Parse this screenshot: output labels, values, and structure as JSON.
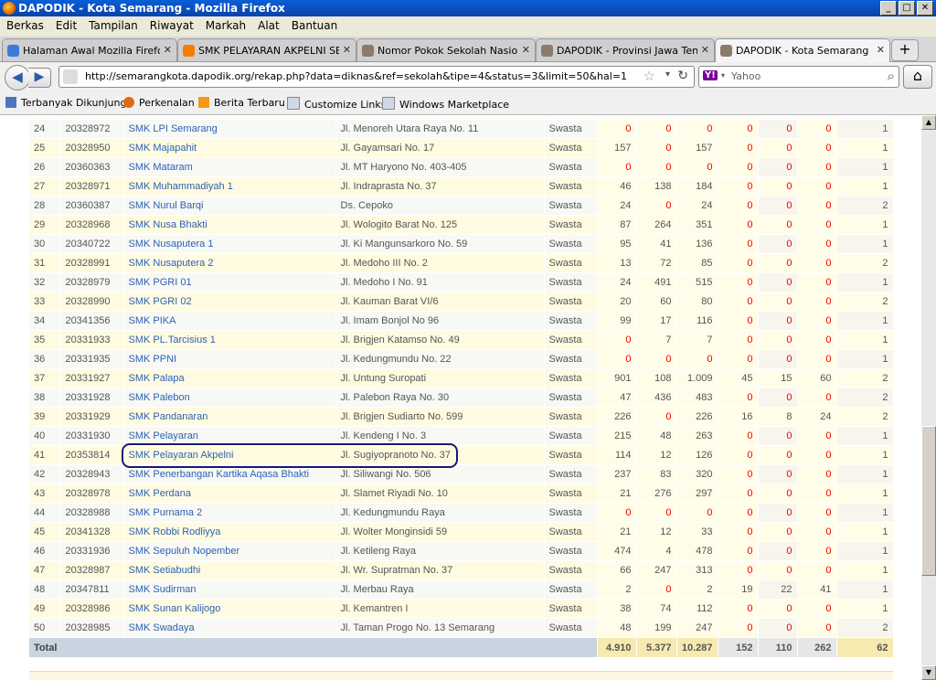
{
  "window": {
    "title": "DAPODIK - Kota Semarang - Mozilla Firefox",
    "buttons": [
      "_",
      "□",
      "✕"
    ]
  },
  "menu": [
    "Berkas",
    "Edit",
    "Tampilan",
    "Riwayat",
    "Markah",
    "Alat",
    "Bantuan"
  ],
  "tabs": [
    {
      "label": "Halaman Awal Mozilla Firefox",
      "icon": "google-icon",
      "color": "#3b7bd8"
    },
    {
      "label": "SMK PELAYARAN AKPELNI SE...",
      "icon": "blogger-icon",
      "color": "#f57d00"
    },
    {
      "label": "Nomor Pokok Sekolah Nasiona...",
      "icon": "dapodik-icon",
      "color": "#8a7b6a"
    },
    {
      "label": "DAPODIK - Provinsi Jawa Ten...",
      "icon": "dapodik-icon",
      "color": "#8a7b6a"
    },
    {
      "label": "DAPODIK - Kota Semarang",
      "icon": "dapodik-icon",
      "color": "#8a7b6a"
    }
  ],
  "nav": {
    "url": "http://semarangkota.dapodik.org/rekap.php?data=diknas&ref=sekolah&tipe=4&status=3&limit=50&hal=1",
    "search_placeholder": "Yahoo",
    "search_logo": "Y!"
  },
  "bookmarks": [
    {
      "label": "Terbanyak Dikunjungi",
      "icon": "search-doc-icon",
      "color": "#4a78c0"
    },
    {
      "label": "Perkenalan",
      "icon": "firefox-icon",
      "color": "#e06a10"
    },
    {
      "label": "Berita Terbaru",
      "icon": "rss-icon",
      "color": "#f39a1a"
    },
    {
      "label": "Customize Links",
      "icon": "page-icon",
      "color": "#cfd8e6"
    },
    {
      "label": "Windows Marketplace",
      "icon": "page-icon",
      "color": "#cfd8e6"
    }
  ],
  "table": {
    "rows": [
      [
        "24",
        "20328972",
        "SMK LPI Semarang",
        "Jl. Menoreh Utara Raya No. 11",
        "Swasta",
        "0",
        "0",
        "0",
        "0",
        "0",
        "0",
        "1"
      ],
      [
        "25",
        "20328950",
        "SMK Majapahit",
        "Jl. Gayamsari No. 17",
        "Swasta",
        "157",
        "0",
        "157",
        "0",
        "0",
        "0",
        "1"
      ],
      [
        "26",
        "20360363",
        "SMK Mataram",
        "Jl. MT Haryono No. 403-405",
        "Swasta",
        "0",
        "0",
        "0",
        "0",
        "0",
        "0",
        "1"
      ],
      [
        "27",
        "20328971",
        "SMK Muhammadiyah 1",
        "Jl. Indraprasta No. 37",
        "Swasta",
        "46",
        "138",
        "184",
        "0",
        "0",
        "0",
        "1"
      ],
      [
        "28",
        "20360387",
        "SMK Nurul Barqi",
        "Ds. Cepoko",
        "Swasta",
        "24",
        "0",
        "24",
        "0",
        "0",
        "0",
        "2"
      ],
      [
        "29",
        "20328968",
        "SMK Nusa Bhakti",
        "Jl. Wologito Barat No. 125",
        "Swasta",
        "87",
        "264",
        "351",
        "0",
        "0",
        "0",
        "1"
      ],
      [
        "30",
        "20340722",
        "SMK Nusaputera 1",
        "Jl. Ki Mangunsarkoro No. 59",
        "Swasta",
        "95",
        "41",
        "136",
        "0",
        "0",
        "0",
        "1"
      ],
      [
        "31",
        "20328991",
        "SMK Nusaputera 2",
        "Jl. Medoho III No. 2",
        "Swasta",
        "13",
        "72",
        "85",
        "0",
        "0",
        "0",
        "2"
      ],
      [
        "32",
        "20328979",
        "SMK PGRI 01",
        "Jl. Medoho I No. 91",
        "Swasta",
        "24",
        "491",
        "515",
        "0",
        "0",
        "0",
        "1"
      ],
      [
        "33",
        "20328990",
        "SMK PGRI 02",
        "Jl. Kauman Barat VI/6",
        "Swasta",
        "20",
        "60",
        "80",
        "0",
        "0",
        "0",
        "2"
      ],
      [
        "34",
        "20341356",
        "SMK PIKA",
        "Jl. Imam Bonjol No 96",
        "Swasta",
        "99",
        "17",
        "116",
        "0",
        "0",
        "0",
        "1"
      ],
      [
        "35",
        "20331933",
        "SMK PL.Tarcisius 1",
        "Jl. Brigjen Katamso No. 49",
        "Swasta",
        "0",
        "7",
        "7",
        "0",
        "0",
        "0",
        "1"
      ],
      [
        "36",
        "20331935",
        "SMK PPNI",
        "Jl. Kedungmundu No. 22",
        "Swasta",
        "0",
        "0",
        "0",
        "0",
        "0",
        "0",
        "1"
      ],
      [
        "37",
        "20331927",
        "SMK Palapa",
        "Jl. Untung Suropati",
        "Swasta",
        "901",
        "108",
        "1.009",
        "45",
        "15",
        "60",
        "2"
      ],
      [
        "38",
        "20331928",
        "SMK Palebon",
        "Jl. Palebon Raya No. 30",
        "Swasta",
        "47",
        "436",
        "483",
        "0",
        "0",
        "0",
        "2"
      ],
      [
        "39",
        "20331929",
        "SMK Pandanaran",
        "Jl. Brigjen Sudiarto No. 599",
        "Swasta",
        "226",
        "0",
        "226",
        "16",
        "8",
        "24",
        "2"
      ],
      [
        "40",
        "20331930",
        "SMK Pelayaran",
        "Jl. Kendeng I No. 3",
        "Swasta",
        "215",
        "48",
        "263",
        "0",
        "0",
        "0",
        "1"
      ],
      [
        "41",
        "20353814",
        "SMK Pelayaran Akpelni",
        "Jl. Sugiyopranoto No. 37",
        "Swasta",
        "114",
        "12",
        "126",
        "0",
        "0",
        "0",
        "1"
      ],
      [
        "42",
        "20328943",
        "SMK Penerbangan Kartika Aqasa Bhakti",
        "Jl. Siliwangi No. 506",
        "Swasta",
        "237",
        "83",
        "320",
        "0",
        "0",
        "0",
        "1"
      ],
      [
        "43",
        "20328978",
        "SMK Perdana",
        "Jl. Slamet Riyadi No. 10",
        "Swasta",
        "21",
        "276",
        "297",
        "0",
        "0",
        "0",
        "1"
      ],
      [
        "44",
        "20328988",
        "SMK Purnama 2",
        "Jl. Kedungmundu Raya",
        "Swasta",
        "0",
        "0",
        "0",
        "0",
        "0",
        "0",
        "1"
      ],
      [
        "45",
        "20341328",
        "SMK Robbi Rodliyya",
        "Jl. Wolter Monginsidi 59",
        "Swasta",
        "21",
        "12",
        "33",
        "0",
        "0",
        "0",
        "1"
      ],
      [
        "46",
        "20331936",
        "SMK Sepuluh Nopember",
        "Jl. Ketileng Raya",
        "Swasta",
        "474",
        "4",
        "478",
        "0",
        "0",
        "0",
        "1"
      ],
      [
        "47",
        "20328987",
        "SMK Setiabudhi",
        "Jl. Wr. Supratman No. 37",
        "Swasta",
        "66",
        "247",
        "313",
        "0",
        "0",
        "0",
        "1"
      ],
      [
        "48",
        "20347811",
        "SMK Sudirman",
        "Jl. Merbau Raya",
        "Swasta",
        "2",
        "0",
        "2",
        "19",
        "22",
        "41",
        "1"
      ],
      [
        "49",
        "20328986",
        "SMK Sunan Kalijogo",
        "Jl. Kemantren I",
        "Swasta",
        "38",
        "74",
        "112",
        "0",
        "0",
        "0",
        "1"
      ],
      [
        "50",
        "20328985",
        "SMK Swadaya",
        "Jl. Taman Progo No. 13 Semarang",
        "Swasta",
        "48",
        "199",
        "247",
        "0",
        "0",
        "0",
        "2"
      ]
    ],
    "total_label": "Total",
    "totals": [
      "4.910",
      "5.377",
      "10.287",
      "152",
      "110",
      "262",
      "62"
    ],
    "highlighted_row": "41"
  },
  "colors": {
    "zero": "#e00000",
    "link": "#2c62b4",
    "total_bg": "#c8d4e0",
    "total_num_bg": "#f7eab0"
  }
}
